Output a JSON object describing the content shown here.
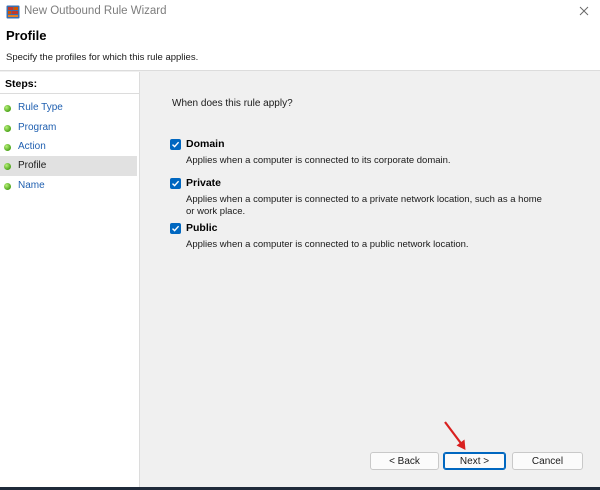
{
  "window": {
    "title": "New Outbound Rule Wizard"
  },
  "header": {
    "title": "Profile",
    "subtitle": "Specify the profiles for which this rule applies."
  },
  "steps": {
    "heading": "Steps:",
    "items": [
      {
        "label": "Rule Type"
      },
      {
        "label": "Program"
      },
      {
        "label": "Action"
      },
      {
        "label": "Profile",
        "active": true
      },
      {
        "label": "Name"
      }
    ]
  },
  "main": {
    "question": "When does this rule apply?",
    "options": [
      {
        "label": "Domain",
        "checked": true,
        "description": "Applies when a computer is connected to its corporate domain."
      },
      {
        "label": "Private",
        "checked": true,
        "description_line1": "Applies when a computer is connected to a private network location, such as a home",
        "description_line2": "or work place."
      },
      {
        "label": "Public",
        "checked": true,
        "description": "Applies when a computer is connected to a public network location."
      }
    ]
  },
  "buttons": {
    "back": "< Back",
    "next": "Next >",
    "cancel": "Cancel"
  },
  "colors": {
    "accent": "#0067c0",
    "link": "#1f5fb0",
    "step_dot": "#4ea51b",
    "annotation_arrow": "#d9201f"
  },
  "icons": {
    "app": "firewall-icon",
    "close": "close-icon",
    "check": "checkmark-icon",
    "annotation": "red-arrow-icon"
  }
}
